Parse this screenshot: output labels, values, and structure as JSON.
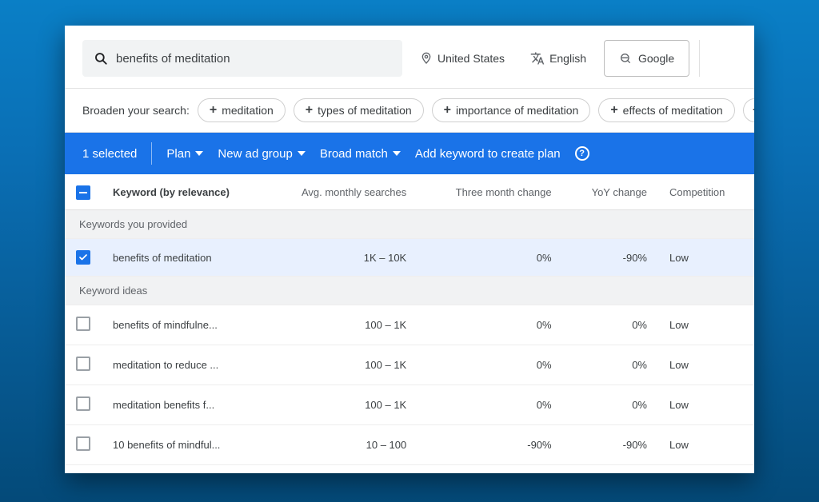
{
  "search": {
    "value": "benefits of meditation"
  },
  "filters": {
    "location": "United States",
    "language": "English",
    "network": "Google"
  },
  "broaden": {
    "label": "Broaden your search:",
    "chips": [
      "meditation",
      "types of meditation",
      "importance of meditation",
      "effects of meditation"
    ]
  },
  "bluebar": {
    "selected": "1 selected",
    "plan": "Plan",
    "ad_group": "New ad group",
    "match": "Broad match",
    "add_to_plan": "Add keyword to create plan"
  },
  "columns": {
    "keyword": "Keyword (by relevance)",
    "avg": "Avg. monthly searches",
    "three_month": "Three month change",
    "yoy": "YoY change",
    "competition": "Competition"
  },
  "sections": {
    "provided": "Keywords you provided",
    "ideas": "Keyword ideas"
  },
  "rows_provided": [
    {
      "keyword": "benefits of meditation",
      "avg": "1K – 10K",
      "three_month": "0%",
      "yoy": "-90%",
      "competition": "Low",
      "checked": true
    }
  ],
  "rows_ideas": [
    {
      "keyword": "benefits of mindfulne...",
      "avg": "100 – 1K",
      "three_month": "0%",
      "yoy": "0%",
      "competition": "Low"
    },
    {
      "keyword": "meditation to reduce ...",
      "avg": "100 – 1K",
      "three_month": "0%",
      "yoy": "0%",
      "competition": "Low"
    },
    {
      "keyword": "meditation benefits f...",
      "avg": "100 – 1K",
      "three_month": "0%",
      "yoy": "0%",
      "competition": "Low"
    },
    {
      "keyword": "10 benefits of mindful...",
      "avg": "10 – 100",
      "three_month": "-90%",
      "yoy": "-90%",
      "competition": "Low"
    }
  ]
}
